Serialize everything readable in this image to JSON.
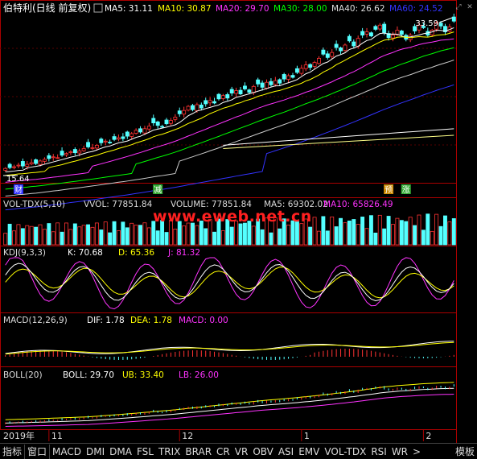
{
  "colors": {
    "bg": "#000000",
    "up": "#ff3333",
    "down": "#54ffff",
    "ma5": "#ffffff",
    "ma10": "#ffff00",
    "ma20": "#ff33ff",
    "ma30": "#00ff00",
    "ma40": "#cccccc",
    "ma60": "#3333ff",
    "axis": "#aa0000"
  },
  "main": {
    "title": "伯特利(日线 前复权)",
    "ma_labels": [
      {
        "text": "MA5: 31.11",
        "color": "#ffffff"
      },
      {
        "text": "MA10: 30.87",
        "color": "#ffff00"
      },
      {
        "text": "MA20: 29.70",
        "color": "#ff33ff"
      },
      {
        "text": "MA30: 28.00",
        "color": "#00ff00"
      },
      {
        "text": "MA40: 26.62",
        "color": "#dddddd"
      },
      {
        "text": "MA60: 24.52",
        "color": "#3333ff"
      }
    ],
    "high_label": "33.59",
    "low_label": "15.64",
    "events": [
      {
        "text": "财",
        "bg": "#3333ff",
        "fg": "#ffffff",
        "index": 3
      },
      {
        "text": "减",
        "bg": "#33aa33",
        "fg": "#ffffff",
        "index": 35
      },
      {
        "text": "预",
        "bg": "#cc8800",
        "fg": "#ffffff",
        "index": 88
      },
      {
        "text": "涨",
        "bg": "#33aa33",
        "fg": "#ffffff",
        "index": 92
      }
    ]
  },
  "vol": {
    "title": "VOL-TDX(5,10)",
    "labels": [
      {
        "text": "VVOL: 77851.84",
        "color": "#dddddd"
      },
      {
        "text": "VOLUME: 77851.84",
        "color": "#dddddd"
      },
      {
        "text": "MA5: 69302.02",
        "color": "#dddddd"
      },
      {
        "text": "MA10: 65826.49",
        "color": "#ff33ff"
      }
    ],
    "watermark": "www.eweb.net.cn"
  },
  "kdj": {
    "title": "KDJ(9,3,3)",
    "labels": [
      {
        "text": "K: 70.68",
        "color": "#ffffff"
      },
      {
        "text": "D: 65.36",
        "color": "#ffff00"
      },
      {
        "text": "J: 81.32",
        "color": "#ff33ff"
      }
    ]
  },
  "macd": {
    "title": "MACD(12,26,9)",
    "labels": [
      {
        "text": "DIF: 1.78",
        "color": "#ffffff"
      },
      {
        "text": "DEA: 1.78",
        "color": "#ffff00"
      },
      {
        "text": "MACD: 0.00",
        "color": "#ff33ff"
      }
    ]
  },
  "boll": {
    "title": "BOLL(20)",
    "labels": [
      {
        "text": "BOLL: 29.70",
        "color": "#ffffff"
      },
      {
        "text": "UB: 33.40",
        "color": "#ffff00"
      },
      {
        "text": "LB: 26.00",
        "color": "#ff33ff"
      }
    ]
  },
  "xaxis": {
    "labels": [
      {
        "text": "2019年",
        "index": 0
      },
      {
        "text": "11",
        "index": 10
      },
      {
        "text": "12",
        "index": 40
      },
      {
        "text": "1",
        "index": 68
      },
      {
        "text": "2",
        "index": 96
      }
    ]
  },
  "tabs": [
    "指标",
    "窗口",
    "MACD",
    "DMI",
    "DMA",
    "FSL",
    "TRIX",
    "BRAR",
    "CR",
    "VR",
    "OBV",
    "ASI",
    "EMV",
    "VOL-TDX",
    "RSI",
    "WR",
    ">",
    "模板"
  ],
  "chart_data": {
    "type": "candlestick",
    "title": "伯特利(日线 前复权)",
    "ylim": [
      15.64,
      33.59
    ],
    "candles_close_approx": [
      15.8,
      15.9,
      16.0,
      16.2,
      16.1,
      16.3,
      16.5,
      16.4,
      16.7,
      16.9,
      17.0,
      17.2,
      17.1,
      17.4,
      17.6,
      17.8,
      17.7,
      17.9,
      18.2,
      18.4,
      18.3,
      18.6,
      18.9,
      19.1,
      18.9,
      19.3,
      19.5,
      19.4,
      19.7,
      20.0,
      20.4,
      20.2,
      20.6,
      20.9,
      21.3,
      21.0,
      20.8,
      21.2,
      21.6,
      22.0,
      22.4,
      22.8,
      23.3,
      22.9,
      23.5,
      23.1,
      23.6,
      24.0,
      23.7,
      24.2,
      24.6,
      24.3,
      24.9,
      25.2,
      24.8,
      25.4,
      25.0,
      25.7,
      26.0,
      25.6,
      26.2,
      25.9,
      26.4,
      26.1,
      26.6,
      27.0,
      26.8,
      27.4,
      27.9,
      28.3,
      28.0,
      28.6,
      29.1,
      29.6,
      29.2,
      29.8,
      30.4,
      30.0,
      30.7,
      31.2,
      30.6,
      31.5,
      31.9,
      32.3,
      31.8,
      32.6,
      33.1,
      32.2,
      31.6,
      31.9,
      32.5,
      32.0,
      31.4,
      31.9,
      32.4,
      33.1,
      32.8,
      31.9,
      32.5,
      33.4,
      33.0,
      32.3,
      32.9,
      33.59
    ],
    "indicators": {
      "MA5": 31.11,
      "MA10": 30.87,
      "MA20": 29.7,
      "MA30": 28.0,
      "MA40": 26.62,
      "MA60": 24.52,
      "VVOL": 77851.84,
      "VOLUME": 77851.84,
      "VOL_MA5": 69302.02,
      "VOL_MA10": 65826.49,
      "K": 70.68,
      "D": 65.36,
      "J": 81.32,
      "DIF": 1.78,
      "DEA": 1.78,
      "MACD": 0.0,
      "BOLL": 29.7,
      "UB": 33.4,
      "LB": 26.0
    }
  }
}
